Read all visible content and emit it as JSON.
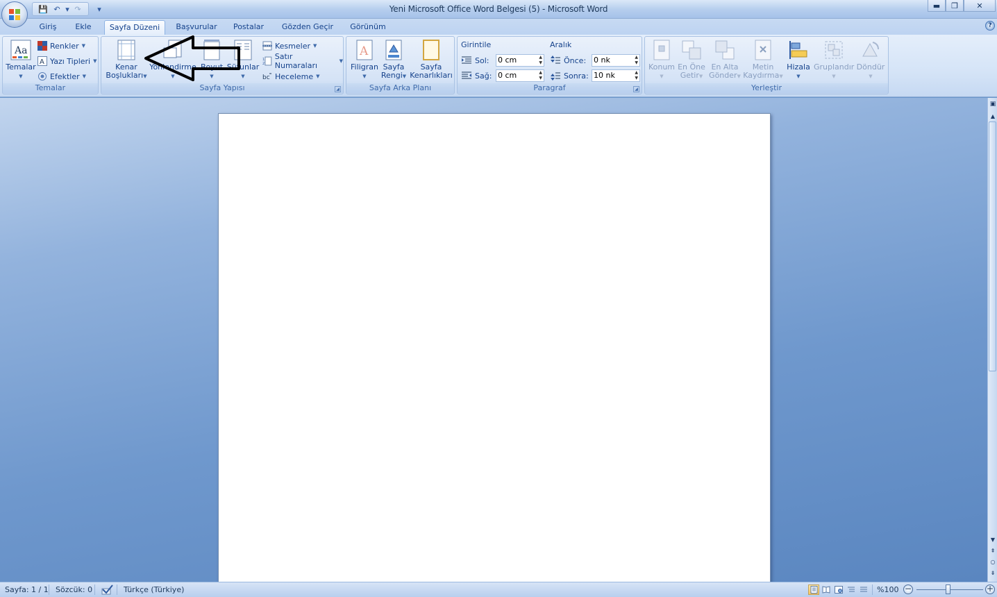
{
  "window": {
    "title": "Yeni Microsoft Office Word Belgesi (5) - Microsoft Word",
    "minimize": "▬",
    "restore": "❐",
    "close": "✕"
  },
  "qat": {
    "save": "💾",
    "undo": "↶",
    "undo_drop": "▾",
    "redo": "↷",
    "customize": "▾"
  },
  "tabs": [
    {
      "label": "Giriş"
    },
    {
      "label": "Ekle"
    },
    {
      "label": "Sayfa Düzeni"
    },
    {
      "label": "Başvurular"
    },
    {
      "label": "Postalar"
    },
    {
      "label": "Gözden Geçir"
    },
    {
      "label": "Görünüm"
    }
  ],
  "help": "?",
  "groups": {
    "temalar": {
      "label": "Temalar",
      "temalar_btn": "Temalar",
      "renkler": "Renkler",
      "yazi_tipleri": "Yazı Tipleri",
      "efektler": "Efektler"
    },
    "sayfa_yapisi": {
      "label": "Sayfa Yapısı",
      "kenar_1": "Kenar",
      "kenar_2": "Boşlukları",
      "yonlendirme": "Yönlendirme",
      "boyut": "Boyut",
      "sutunlar": "Sütunlar",
      "kesmeler": "Kesmeler",
      "satir_numaralari": "Satır Numaraları",
      "heceleme": "Heceleme"
    },
    "sayfa_arka_plani": {
      "label": "Sayfa Arka Planı",
      "filigran": "Filigran",
      "sayfa_rengi_1": "Sayfa",
      "sayfa_rengi_2": "Rengi",
      "sayfa_kenar_1": "Sayfa",
      "sayfa_kenar_2": "Kenarlıkları"
    },
    "paragraf": {
      "label": "Paragraf",
      "girintile": "Girintile",
      "sol_label": "Sol:",
      "sol_value": "0 cm",
      "sag_label": "Sağ:",
      "sag_value": "0 cm",
      "aralik": "Aralık",
      "once_label": "Önce:",
      "once_value": "0 nk",
      "sonra_label": "Sonra:",
      "sonra_value": "10 nk"
    },
    "yerlestir": {
      "label": "Yerleştir",
      "konum": "Konum",
      "en_one_1": "En Öne",
      "en_one_2": "Getir",
      "en_alta_1": "En Alta",
      "en_alta_2": "Gönder",
      "metin_1": "Metin",
      "metin_2": "Kaydırma",
      "hizala": "Hizala",
      "gruplandir": "Gruplandır",
      "dondur": "Döndür"
    }
  },
  "status": {
    "sayfa": "Sayfa: 1 / 1",
    "sozcuk": "Sözcük: 0",
    "dil": "Türkçe (Türkiye)",
    "zoom": "%100"
  },
  "colors": {
    "ribbon_text": "#15428b",
    "active_view": "#f8c55d",
    "background": "#6c97cb"
  }
}
